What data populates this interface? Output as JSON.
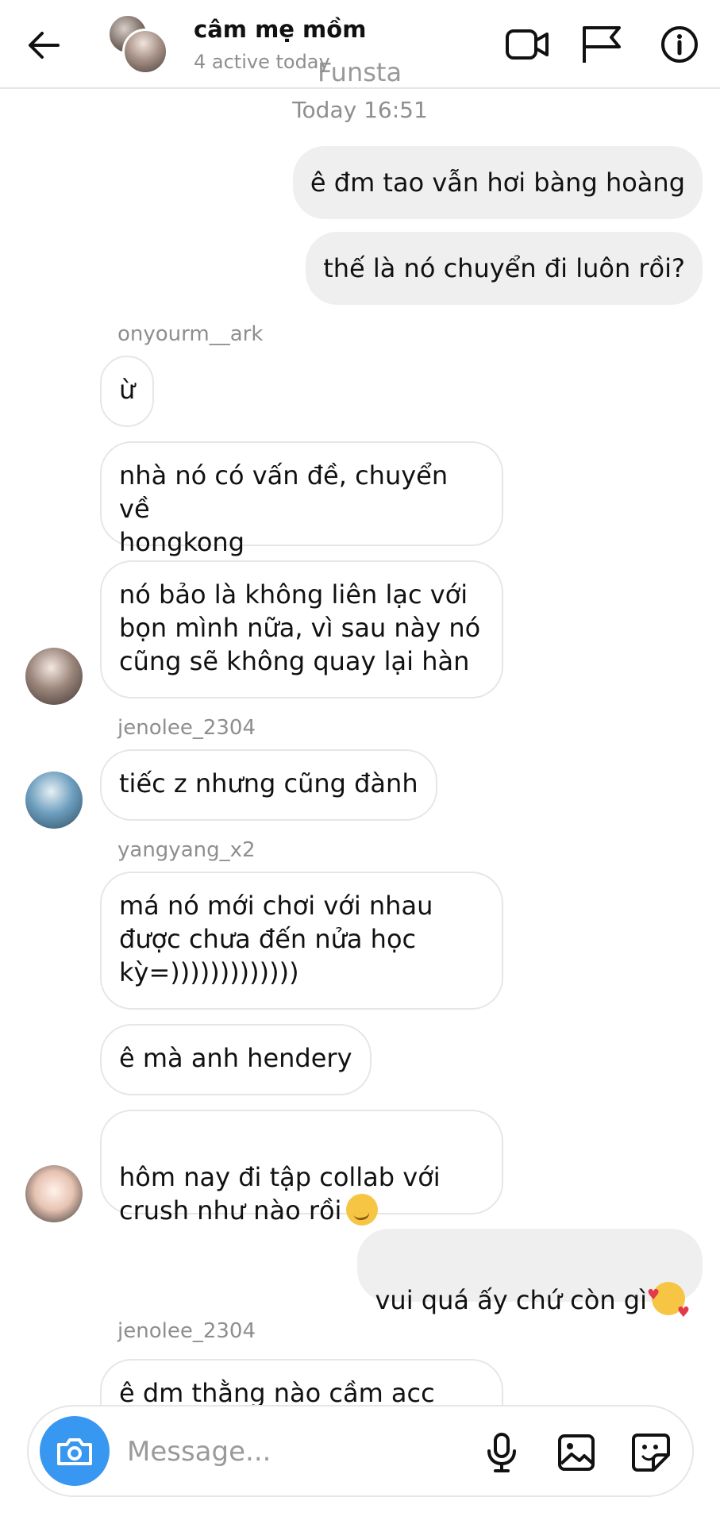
{
  "header": {
    "title": "câm mẹ mồm",
    "subtitle": "4 active today",
    "watermark": "Funsta",
    "icons": [
      "back-arrow-icon",
      "video-call-icon",
      "flag-icon",
      "info-icon"
    ]
  },
  "chat": {
    "timestamp": "Today 16:51",
    "messages": [
      {
        "side": "out",
        "text": "ê đm tao vẫn hơi bàng hoàng"
      },
      {
        "side": "out",
        "text": "thế là nó chuyển đi luôn rồi?"
      },
      {
        "side": "sender",
        "text": "onyourm__ark"
      },
      {
        "side": "in",
        "text": "ừ"
      },
      {
        "side": "in",
        "text": "nhà nó có vấn đề, chuyển về\nhongkong"
      },
      {
        "side": "in",
        "text": "nó bảo là không liên lạc với\nbọn mình nữa, vì sau này nó\ncũng sẽ không quay lại hàn"
      },
      {
        "side": "sender",
        "text": "jenolee_2304"
      },
      {
        "side": "in",
        "text": "tiếc z nhưng cũng đành"
      },
      {
        "side": "sender",
        "text": "yangyang_x2"
      },
      {
        "side": "in",
        "text": "má nó mới chơi với nhau\nđược chưa đến nửa học\nkỳ=)))))))))))))"
      },
      {
        "side": "in",
        "text": "ê mà anh hendery"
      },
      {
        "side": "in",
        "text": "hôm nay đi tập collab với\ncrush như nào rồi",
        "emoji": "smirking-face"
      },
      {
        "side": "out",
        "text": "vui quá ấy chứ còn gì",
        "emoji": "smiling-face-with-hearts"
      },
      {
        "side": "sender",
        "text": "jenolee_2304"
      },
      {
        "side": "in",
        "text": "ê dm thằng nào cầm acc"
      }
    ]
  },
  "composer": {
    "placeholder": "Message...",
    "icons": [
      "camera-icon",
      "microphone-icon",
      "gallery-icon",
      "sticker-icon"
    ],
    "accent": "#3897f0"
  },
  "colors": {
    "outgoing_bubble": "#efefef",
    "incoming_border": "#e6e6e6",
    "muted_text": "#8e8e8e"
  }
}
